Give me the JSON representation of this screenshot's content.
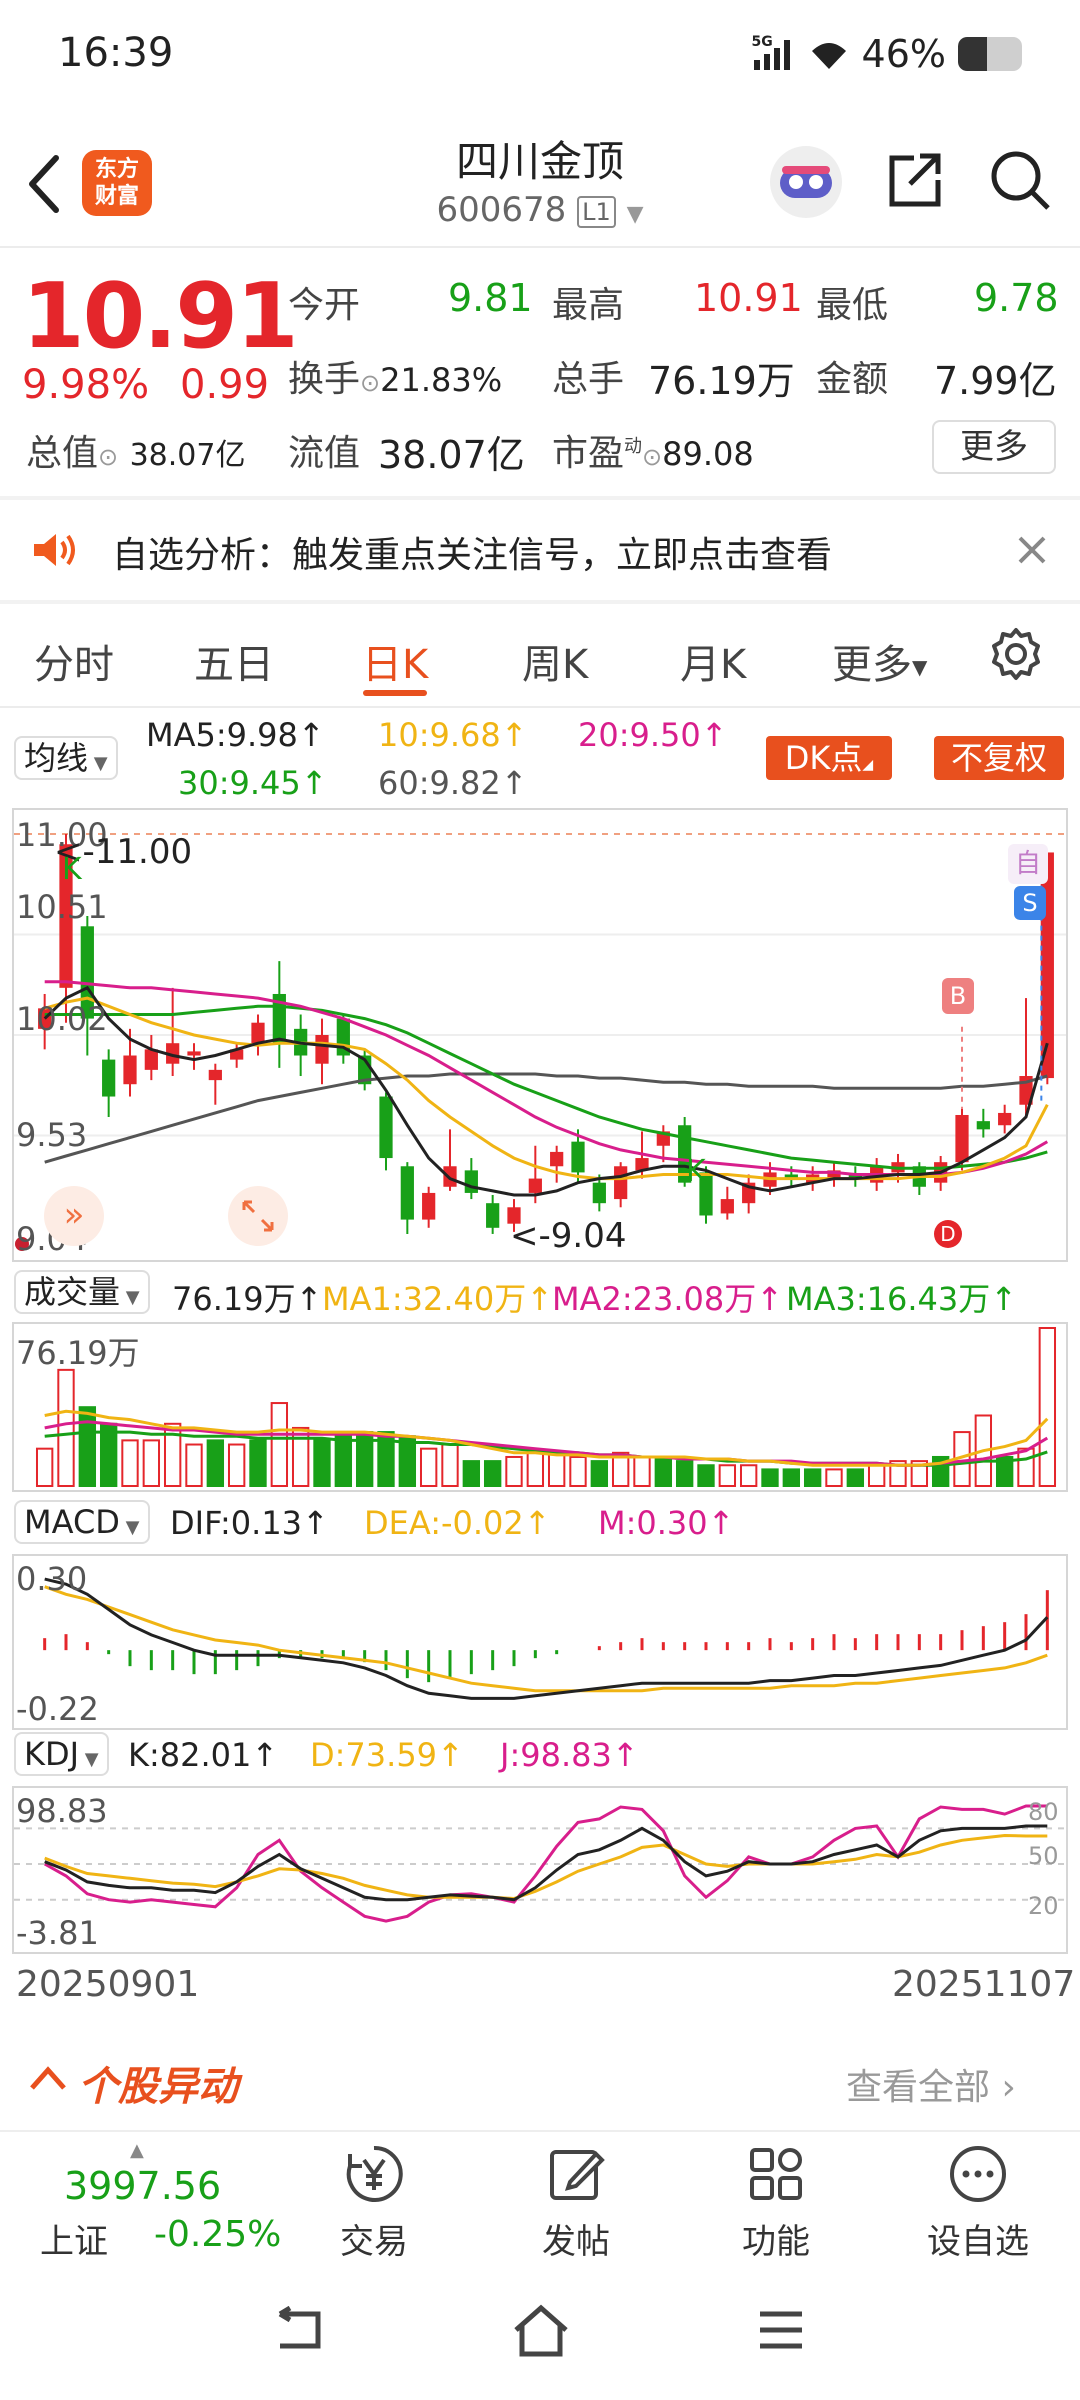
{
  "status": {
    "time": "16:39",
    "net": "5G",
    "battery": "46%",
    "battery_level": 0.46
  },
  "header": {
    "logo_top": "东方",
    "logo_bottom": "财富",
    "name": "四川金顶",
    "code": "600678",
    "level": "L1"
  },
  "quote": {
    "price": "10.91",
    "change_pct": "9.98%",
    "change": "0.99",
    "open_label": "今开",
    "open": "9.81",
    "high_label": "最高",
    "high": "10.91",
    "low_label": "最低",
    "low": "9.78",
    "turnover_label": "换手",
    "turnover": "21.83%",
    "volume_label": "总手",
    "volume": "76.19万",
    "amount_label": "金额",
    "amount": "7.99亿",
    "mktcap_label": "总值",
    "mktcap": "38.07亿",
    "float_label": "流值",
    "float": "38.07亿",
    "pe_label": "市盈",
    "pe_sup": "动",
    "pe": "89.08",
    "more_label": "更多"
  },
  "banner": {
    "text": "自选分析：触发重点关注信号，立即点击查看"
  },
  "tabs": [
    "分时",
    "五日",
    "日K",
    "周K",
    "月K",
    "更多"
  ],
  "active_tab": 2,
  "indicators": {
    "ma_select": "均线",
    "ma5": "MA5:9.98",
    "ma10": "10:9.68",
    "ma20": "20:9.50",
    "ma30": "30:9.45",
    "ma60": "60:9.82",
    "dk_btn": "DK点",
    "fq_btn": "不复权",
    "vol_select": "成交量",
    "vol": "76.19万",
    "vol_ma1": "MA1:32.40万",
    "vol_ma2": "MA2:23.08万",
    "vol_ma3": "MA3:16.43万",
    "macd_select": "MACD",
    "dif": "DIF:0.13",
    "dea": "DEA:-0.02",
    "m": "M:0.30",
    "kdj_select": "KDJ",
    "k": "K:82.01",
    "d": "D:73.59",
    "j": "J:98.83"
  },
  "kline_axis": {
    "y1": "11.00",
    "y2": "10.51",
    "y3": "10.02",
    "y4": "9.53",
    "y5": "9.04",
    "max_label": "<-11.00",
    "min_label": "<-9.04",
    "zi": "自",
    "s": "S",
    "b": "B",
    "d": "D",
    "k": "K"
  },
  "vol_axis": {
    "top": "76.19万"
  },
  "macd_axis": {
    "top": "0.30",
    "bottom": "-0.22"
  },
  "kdj_axis": {
    "top": "98.83",
    "bottom": "-3.81",
    "r80": "80",
    "r50": "50",
    "r20": "20"
  },
  "dates": {
    "start": "20250901",
    "end": "20251107"
  },
  "section": {
    "title": "个股异动",
    "link": "查看全部"
  },
  "index": {
    "value": "3997.56",
    "name": "上证",
    "change": "-0.25%"
  },
  "bottom_nav": [
    "交易",
    "发帖",
    "功能",
    "设自选"
  ],
  "colors": {
    "up": "#e4262b",
    "down": "#18a018",
    "accent": "#e8501e",
    "ma5": "#222222",
    "ma10": "#f0b414",
    "ma20": "#d81e8c",
    "ma30": "#18a018",
    "ma60": "#555555"
  },
  "chart_data": {
    "type": "candlestick",
    "price_range": [
      9.04,
      11.0
    ],
    "candles": [
      [
        10.05,
        10.15,
        9.95,
        10.22
      ],
      [
        10.25,
        10.95,
        10.08,
        11.0
      ],
      [
        10.55,
        10.1,
        9.92,
        10.6
      ],
      [
        9.9,
        9.72,
        9.62,
        9.95
      ],
      [
        9.78,
        9.92,
        9.72,
        10.05
      ],
      [
        9.85,
        9.95,
        9.8,
        10.02
      ],
      [
        9.88,
        9.98,
        9.82,
        10.25
      ],
      [
        9.92,
        9.94,
        9.85,
        9.98
      ],
      [
        9.8,
        9.85,
        9.68,
        9.88
      ],
      [
        9.9,
        9.95,
        9.86,
        9.98
      ],
      [
        9.98,
        10.08,
        9.92,
        10.12
      ],
      [
        10.22,
        9.98,
        9.86,
        10.38
      ],
      [
        10.05,
        9.92,
        9.82,
        10.12
      ],
      [
        9.88,
        10.02,
        9.78,
        10.1
      ],
      [
        10.1,
        9.92,
        9.88,
        10.12
      ],
      [
        9.92,
        9.78,
        9.75,
        9.95
      ],
      [
        9.72,
        9.42,
        9.36,
        9.74
      ],
      [
        9.38,
        9.12,
        9.05,
        9.4
      ],
      [
        9.12,
        9.25,
        9.08,
        9.28
      ],
      [
        9.28,
        9.38,
        9.26,
        9.56
      ],
      [
        9.36,
        9.25,
        9.22,
        9.42
      ],
      [
        9.2,
        9.08,
        9.05,
        9.24
      ],
      [
        9.1,
        9.18,
        9.06,
        9.22
      ],
      [
        9.25,
        9.32,
        9.2,
        9.48
      ],
      [
        9.38,
        9.45,
        9.3,
        9.48
      ],
      [
        9.5,
        9.35,
        9.3,
        9.56
      ],
      [
        9.3,
        9.2,
        9.16,
        9.34
      ],
      [
        9.22,
        9.38,
        9.18,
        9.4
      ],
      [
        9.36,
        9.42,
        9.32,
        9.55
      ],
      [
        9.48,
        9.55,
        9.4,
        9.58
      ],
      [
        9.58,
        9.3,
        9.28,
        9.62
      ],
      [
        9.35,
        9.14,
        9.1,
        9.38
      ],
      [
        9.15,
        9.22,
        9.12,
        9.28
      ],
      [
        9.2,
        9.3,
        9.15,
        9.34
      ],
      [
        9.28,
        9.35,
        9.24,
        9.4
      ],
      [
        9.34,
        9.32,
        9.28,
        9.38
      ],
      [
        9.3,
        9.34,
        9.26,
        9.38
      ],
      [
        9.32,
        9.36,
        9.28,
        9.4
      ],
      [
        9.34,
        9.32,
        9.28,
        9.38
      ],
      [
        9.3,
        9.38,
        9.26,
        9.42
      ],
      [
        9.35,
        9.4,
        9.3,
        9.44
      ],
      [
        9.38,
        9.28,
        9.24,
        9.4
      ],
      [
        9.3,
        9.4,
        9.26,
        9.43
      ],
      [
        9.4,
        9.63,
        9.36,
        9.66
      ],
      [
        9.6,
        9.56,
        9.52,
        9.66
      ],
      [
        9.58,
        9.64,
        9.54,
        9.68
      ],
      [
        9.68,
        9.82,
        9.62,
        10.2
      ],
      [
        9.81,
        10.91,
        9.78,
        10.91
      ]
    ],
    "ma5": [
      10.1,
      10.2,
      10.25,
      10.1,
      10.0,
      9.95,
      9.92,
      9.9,
      9.92,
      9.95,
      9.98,
      10.0,
      9.98,
      9.97,
      9.96,
      9.9,
      9.75,
      9.58,
      9.42,
      9.32,
      9.28,
      9.26,
      9.24,
      9.24,
      9.26,
      9.3,
      9.32,
      9.33,
      9.36,
      9.38,
      9.38,
      9.36,
      9.32,
      9.28,
      9.26,
      9.28,
      9.3,
      9.32,
      9.32,
      9.33,
      9.34,
      9.34,
      9.35,
      9.4,
      9.46,
      9.52,
      9.62,
      9.98
    ],
    "ma10": [
      10.15,
      10.18,
      10.2,
      10.16,
      10.12,
      10.08,
      10.05,
      10.02,
      10.0,
      9.98,
      9.97,
      9.98,
      9.98,
      9.98,
      9.97,
      9.95,
      9.88,
      9.8,
      9.7,
      9.62,
      9.55,
      9.48,
      9.42,
      9.38,
      9.35,
      9.33,
      9.32,
      9.32,
      9.33,
      9.34,
      9.34,
      9.34,
      9.34,
      9.33,
      9.32,
      9.32,
      9.32,
      9.32,
      9.32,
      9.32,
      9.32,
      9.33,
      9.33,
      9.35,
      9.38,
      9.42,
      9.48,
      9.68
    ],
    "ma20": [
      10.28,
      10.28,
      10.27,
      10.26,
      10.25,
      10.25,
      10.24,
      10.23,
      10.22,
      10.21,
      10.2,
      10.18,
      10.16,
      10.13,
      10.1,
      10.06,
      10.02,
      9.97,
      9.92,
      9.86,
      9.8,
      9.74,
      9.68,
      9.62,
      9.57,
      9.53,
      9.49,
      9.46,
      9.44,
      9.42,
      9.41,
      9.4,
      9.39,
      9.38,
      9.37,
      9.36,
      9.35,
      9.35,
      9.34,
      9.34,
      9.34,
      9.34,
      9.34,
      9.35,
      9.37,
      9.4,
      9.44,
      9.5
    ],
    "ma30": [
      10.12,
      10.12,
      10.12,
      10.12,
      10.12,
      10.12,
      10.12,
      10.13,
      10.14,
      10.15,
      10.16,
      10.16,
      10.15,
      10.14,
      10.12,
      10.1,
      10.07,
      10.03,
      9.98,
      9.93,
      9.88,
      9.83,
      9.78,
      9.74,
      9.7,
      9.66,
      9.62,
      9.59,
      9.56,
      9.54,
      9.52,
      9.5,
      9.48,
      9.46,
      9.44,
      9.42,
      9.41,
      9.4,
      9.39,
      9.38,
      9.37,
      9.37,
      9.37,
      9.38,
      9.39,
      9.4,
      9.42,
      9.45
    ],
    "ma60": [
      9.4,
      9.43,
      9.46,
      9.49,
      9.52,
      9.55,
      9.58,
      9.61,
      9.64,
      9.67,
      9.7,
      9.72,
      9.74,
      9.76,
      9.78,
      9.8,
      9.81,
      9.82,
      9.82,
      9.83,
      9.83,
      9.83,
      9.83,
      9.83,
      9.82,
      9.82,
      9.81,
      9.81,
      9.8,
      9.79,
      9.79,
      9.78,
      9.78,
      9.77,
      9.77,
      9.77,
      9.77,
      9.76,
      9.76,
      9.76,
      9.76,
      9.76,
      9.76,
      9.77,
      9.77,
      9.78,
      9.79,
      9.82
    ],
    "volume_range": [
      0,
      76.19
    ],
    "volume": [
      [
        18,
        1
      ],
      [
        56,
        1
      ],
      [
        38,
        0
      ],
      [
        30,
        0
      ],
      [
        22,
        1
      ],
      [
        22,
        1
      ],
      [
        30,
        1
      ],
      [
        20,
        1
      ],
      [
        22,
        0
      ],
      [
        20,
        1
      ],
      [
        22,
        0
      ],
      [
        40,
        1
      ],
      [
        28,
        1
      ],
      [
        22,
        0
      ],
      [
        26,
        0
      ],
      [
        26,
        0
      ],
      [
        26,
        0
      ],
      [
        24,
        0
      ],
      [
        18,
        1
      ],
      [
        20,
        1
      ],
      [
        12,
        0
      ],
      [
        12,
        0
      ],
      [
        14,
        1
      ],
      [
        16,
        1
      ],
      [
        16,
        1
      ],
      [
        14,
        1
      ],
      [
        12,
        0
      ],
      [
        16,
        1
      ],
      [
        14,
        1
      ],
      [
        14,
        0
      ],
      [
        12,
        0
      ],
      [
        10,
        0
      ],
      [
        10,
        1
      ],
      [
        10,
        1
      ],
      [
        8,
        0
      ],
      [
        8,
        0
      ],
      [
        8,
        0
      ],
      [
        8,
        1
      ],
      [
        8,
        0
      ],
      [
        10,
        1
      ],
      [
        12,
        1
      ],
      [
        12,
        1
      ],
      [
        14,
        0
      ],
      [
        26,
        1
      ],
      [
        34,
        1
      ],
      [
        14,
        0
      ],
      [
        18,
        1
      ],
      [
        76.19,
        1
      ]
    ],
    "vol_ma1": [
      34,
      36,
      35,
      33,
      32,
      30,
      28,
      28,
      27,
      26,
      26,
      27,
      27,
      26,
      26,
      26,
      25,
      24,
      23,
      22,
      20,
      18,
      16,
      16,
      15,
      15,
      14,
      14,
      14,
      14,
      14,
      13,
      13,
      12,
      12,
      11,
      10,
      10,
      10,
      10,
      10,
      10,
      11,
      14,
      17,
      19,
      22,
      32.4
    ],
    "vol_ma2": [
      28,
      30,
      31,
      30,
      29,
      28,
      27,
      27,
      26,
      25,
      25,
      25,
      25,
      25,
      25,
      25,
      24,
      24,
      23,
      22,
      21,
      20,
      19,
      18,
      17,
      16,
      15,
      15,
      14,
      14,
      13,
      13,
      13,
      12,
      12,
      12,
      11,
      11,
      11,
      11,
      10,
      10,
      11,
      12,
      13,
      15,
      17,
      23.08
    ],
    "vol_ma3": [
      24,
      25,
      26,
      26,
      26,
      25,
      25,
      24,
      24,
      24,
      23,
      23,
      23,
      23,
      22,
      22,
      22,
      21,
      21,
      20,
      20,
      19,
      18,
      17,
      16,
      16,
      15,
      15,
      14,
      14,
      13,
      13,
      12,
      12,
      12,
      11,
      11,
      11,
      11,
      11,
      10,
      10,
      10,
      11,
      12,
      12,
      13,
      16.43
    ],
    "macd_range": [
      -0.22,
      0.3
    ],
    "dif": [
      0.28,
      0.26,
      0.22,
      0.16,
      0.1,
      0.06,
      0.03,
      0.0,
      -0.02,
      -0.02,
      -0.02,
      -0.02,
      -0.03,
      -0.04,
      -0.05,
      -0.07,
      -0.1,
      -0.14,
      -0.17,
      -0.18,
      -0.19,
      -0.19,
      -0.19,
      -0.18,
      -0.17,
      -0.16,
      -0.15,
      -0.14,
      -0.13,
      -0.13,
      -0.13,
      -0.13,
      -0.13,
      -0.13,
      -0.12,
      -0.12,
      -0.11,
      -0.1,
      -0.1,
      -0.09,
      -0.08,
      -0.07,
      -0.06,
      -0.04,
      -0.02,
      0.0,
      0.04,
      0.13
    ],
    "dea": [
      0.25,
      0.22,
      0.2,
      0.17,
      0.14,
      0.11,
      0.08,
      0.06,
      0.04,
      0.03,
      0.02,
      0.0,
      -0.01,
      -0.02,
      -0.03,
      -0.04,
      -0.05,
      -0.07,
      -0.09,
      -0.11,
      -0.13,
      -0.14,
      -0.15,
      -0.16,
      -0.16,
      -0.16,
      -0.16,
      -0.16,
      -0.16,
      -0.15,
      -0.15,
      -0.15,
      -0.15,
      -0.15,
      -0.15,
      -0.14,
      -0.14,
      -0.14,
      -0.13,
      -0.13,
      -0.12,
      -0.11,
      -0.1,
      -0.09,
      -0.08,
      -0.07,
      -0.05,
      -0.02
    ],
    "macd_m": [
      0.06,
      0.08,
      0.04,
      -0.02,
      -0.08,
      -0.1,
      -0.1,
      -0.12,
      -0.12,
      -0.1,
      -0.08,
      -0.04,
      -0.04,
      -0.04,
      -0.04,
      -0.06,
      -0.1,
      -0.14,
      -0.16,
      -0.14,
      -0.12,
      -0.1,
      -0.08,
      -0.04,
      -0.02,
      0.0,
      0.02,
      0.04,
      0.06,
      0.04,
      0.04,
      0.04,
      0.04,
      0.04,
      0.06,
      0.04,
      0.06,
      0.08,
      0.06,
      0.08,
      0.08,
      0.08,
      0.08,
      0.1,
      0.12,
      0.14,
      0.18,
      0.3
    ],
    "kdj_range": [
      -3.81,
      98.83
    ],
    "kdj_k": [
      52,
      45,
      35,
      32,
      30,
      30,
      28,
      28,
      26,
      35,
      48,
      58,
      46,
      38,
      30,
      22,
      20,
      20,
      22,
      24,
      23,
      22,
      20,
      30,
      45,
      58,
      62,
      70,
      80,
      70,
      52,
      40,
      44,
      52,
      50,
      50,
      52,
      58,
      62,
      66,
      56,
      70,
      78,
      80,
      80,
      80,
      82.01,
      82.01
    ],
    "kdj_d": [
      55,
      48,
      42,
      40,
      38,
      36,
      34,
      33,
      31,
      35,
      40,
      46,
      45,
      42,
      38,
      32,
      28,
      24,
      22,
      22,
      22,
      22,
      21,
      27,
      35,
      44,
      50,
      56,
      64,
      66,
      58,
      50,
      48,
      50,
      50,
      50,
      50,
      52,
      54,
      58,
      56,
      60,
      66,
      70,
      72,
      74,
      73.59,
      73.59
    ],
    "kdj_j": [
      50,
      40,
      25,
      20,
      18,
      20,
      18,
      16,
      14,
      30,
      58,
      70,
      44,
      30,
      18,
      6,
      2,
      6,
      18,
      24,
      25,
      22,
      18,
      40,
      65,
      85,
      88,
      98,
      96,
      78,
      40,
      22,
      36,
      56,
      50,
      50,
      56,
      70,
      80,
      82,
      56,
      88,
      98,
      96,
      96,
      92,
      98.83,
      98.83
    ]
  }
}
